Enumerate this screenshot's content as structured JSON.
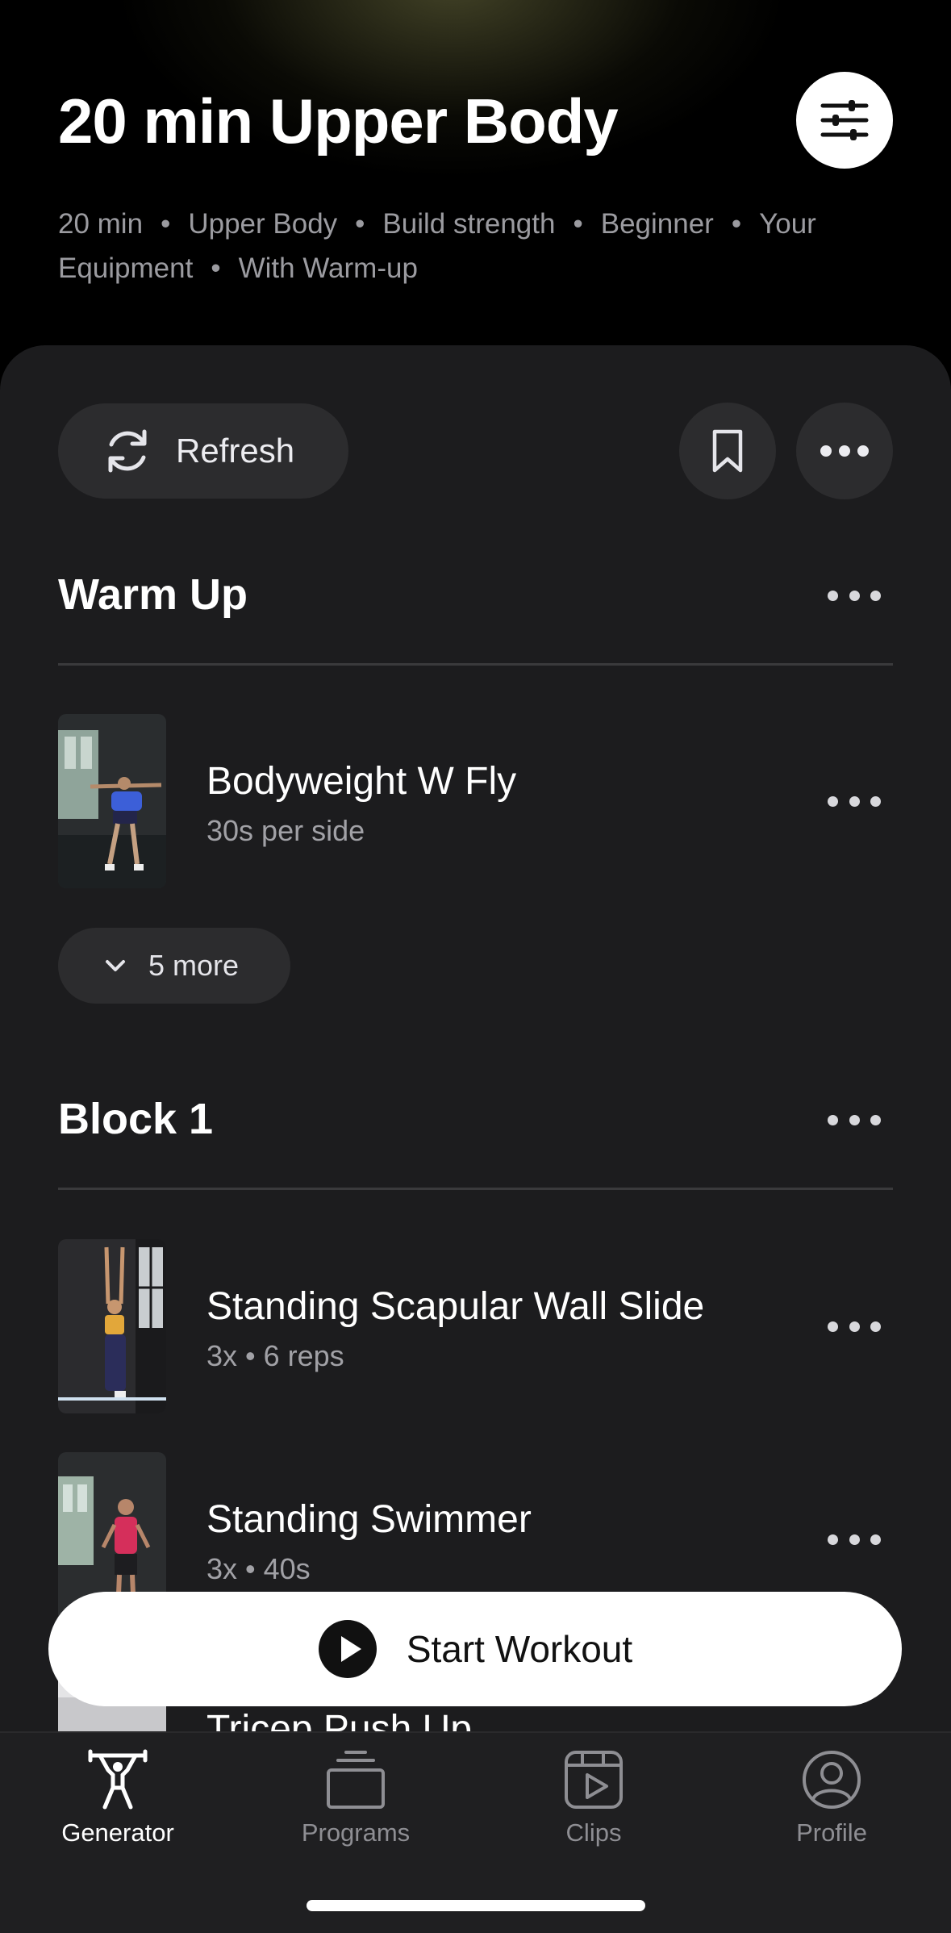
{
  "header": {
    "title": "20 min Upper Body",
    "tags": [
      "20 min",
      "Upper Body",
      "Build strength",
      "Beginner",
      "Your Equipment",
      "With Warm-up"
    ]
  },
  "actions": {
    "refresh_label": "Refresh",
    "bookmark_icon": "bookmark-icon",
    "more_icon": "more-horizontal-icon",
    "filter_icon": "sliders-icon"
  },
  "sections": {
    "warmup": {
      "title": "Warm Up",
      "exercises": [
        {
          "name": "Bodyweight W Fly",
          "meta": "30s per side"
        }
      ],
      "more_label": "5 more"
    },
    "block1": {
      "title": "Block 1",
      "exercises": [
        {
          "name": "Standing Scapular Wall Slide",
          "meta": "3x • 6 reps"
        },
        {
          "name": "Standing Swimmer",
          "meta": "3x • 40s"
        },
        {
          "name": "Tricep Push Up",
          "meta": ""
        }
      ]
    }
  },
  "start_button": {
    "label": "Start Workout"
  },
  "tabbar": {
    "tabs": [
      {
        "label": "Generator",
        "icon": "weightlifter-icon",
        "active": true
      },
      {
        "label": "Programs",
        "icon": "stack-icon",
        "active": false
      },
      {
        "label": "Clips",
        "icon": "play-square-icon",
        "active": false
      },
      {
        "label": "Profile",
        "icon": "person-circle-icon",
        "active": false
      }
    ]
  },
  "colors": {
    "background": "#000000",
    "sheet": "#1c1c1e",
    "pill": "#2c2c2e",
    "secondary_text": "#9b9ba0"
  }
}
